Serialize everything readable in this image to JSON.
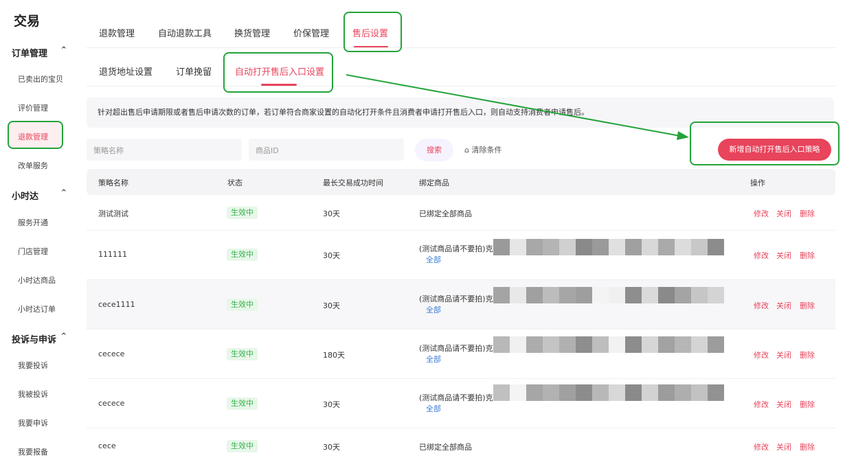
{
  "sidebar": {
    "brand": "交易",
    "groups": [
      {
        "title": "订单管理",
        "chevron": "^",
        "items": [
          "已卖出的宝贝",
          "评价管理",
          "退款管理",
          "改单服务"
        ]
      },
      {
        "title": "小时达",
        "chevron": "^",
        "items": [
          "服务开通",
          "门店管理",
          "小时达商品",
          "小时达订单"
        ]
      },
      {
        "title": "投诉与申诉",
        "chevron": "^",
        "items": [
          "我要投诉",
          "我被投诉",
          "我要申诉",
          "我要报备"
        ]
      }
    ],
    "active_item": "退款管理"
  },
  "tabs": [
    "退款管理",
    "自动退款工具",
    "换货管理",
    "价保管理",
    "售后设置"
  ],
  "active_tab": "售后设置",
  "subtabs": [
    "退货地址设置",
    "订单挽留",
    "自动打开售后入口设置"
  ],
  "active_subtab": "自动打开售后入口设置",
  "notice": "针对超出售后申请期限或者售后申请次数的订单，若订单符合商家设置的自动化打开条件且消费者申请打开售后入口，则自动支持消费者申请售后。",
  "filters": {
    "strategy_placeholder": "策略名称",
    "product_placeholder": "商品ID",
    "search_label": "搜索",
    "clear_label": "清除条件",
    "new_button": "新增自动打开售后入口策略"
  },
  "table": {
    "headers": [
      "策略名称",
      "状态",
      "最长交易成功时间",
      "绑定商品",
      "操作"
    ],
    "rows": [
      {
        "name": "测试测试",
        "status": "生效中",
        "time": "30天",
        "product": "已绑定全部商品",
        "all": ""
      },
      {
        "name": "111111",
        "status": "生效中",
        "time": "30天",
        "product": "(测试商品请不要拍)克",
        "all": "全部"
      },
      {
        "name": "cece1111",
        "status": "生效中",
        "time": "30天",
        "product": "(测试商品请不要拍)克",
        "all": "全部"
      },
      {
        "name": "cecece",
        "status": "生效中",
        "time": "180天",
        "product": "(测试商品请不要拍)克",
        "all": "全部"
      },
      {
        "name": "cecece",
        "status": "生效中",
        "time": "30天",
        "product": "(测试商品请不要拍)克",
        "all": "全部"
      },
      {
        "name": "cece",
        "status": "生效中",
        "time": "30天",
        "product": "已绑定全部商品",
        "all": ""
      }
    ],
    "ops": [
      "修改",
      "关闭",
      "删除"
    ]
  },
  "colors": {
    "accent": "#e8445b",
    "annotation": "#23a33a",
    "status_green": "#35b14b",
    "link": "#3a7bd5"
  }
}
